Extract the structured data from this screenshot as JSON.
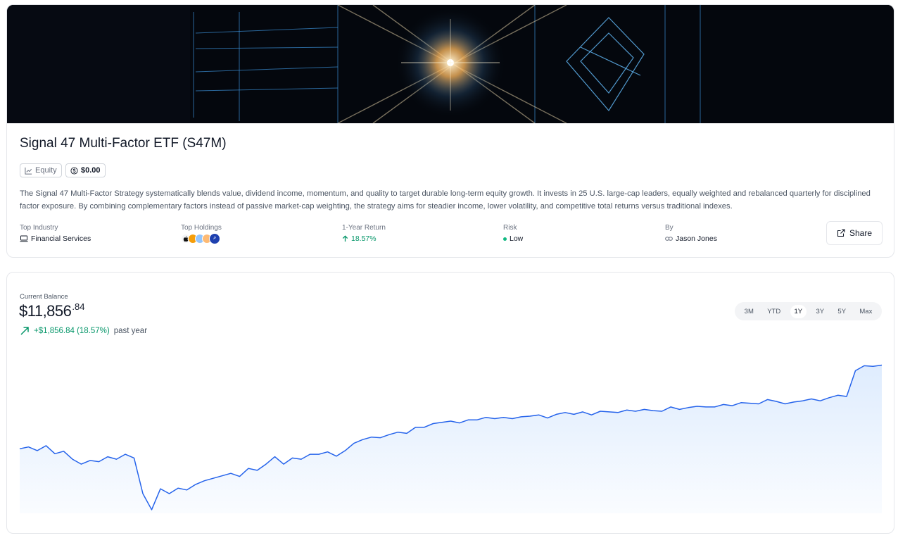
{
  "etf": {
    "title": "Signal 47 Multi-Factor ETF (S47M)",
    "type_badge": "Equity",
    "price_badge": "$0.00",
    "description": "The Signal 47 Multi-Factor Strategy systematically blends value, dividend income, momentum, and quality to target durable long-term equity growth. It invests in 25 U.S. large-cap leaders, equally weighted and rebalanced quarterly for disciplined factor exposure. By combining complementary factors instead of passive market-cap weighting, the strategy aims for steadier income, lower volatility, and competitive total returns versus traditional indexes."
  },
  "stats": {
    "industry_label": "Top Industry",
    "industry_value": "Financial Services",
    "holdings_label": "Top Holdings",
    "holdings_icons": [
      "apple-logo-icon",
      "holding-logo-icon",
      "holding-logo-icon",
      "holding-logo-icon",
      "paypal-logo-icon"
    ],
    "return_label": "1-Year Return",
    "return_value": "18.57%",
    "risk_label": "Risk",
    "risk_value": "Low",
    "by_label": "By",
    "by_value": "Jason Jones"
  },
  "share_label": "Share",
  "balance": {
    "label": "Current Balance",
    "dollars": "$11,856",
    "cents": ".84",
    "change": "+$1,856.84 (18.57%)",
    "period": "past year"
  },
  "ranges": [
    "3M",
    "YTD",
    "1Y",
    "3Y",
    "5Y",
    "Max"
  ],
  "active_range": "1Y",
  "colors": {
    "accent_green": "#059669",
    "line_blue": "#2563eb",
    "fill_blue": "#dbeafe"
  },
  "chart_data": {
    "type": "area",
    "title": "",
    "xlabel": "",
    "ylabel": "",
    "series": [
      {
        "values": [
          10550,
          10580,
          10520,
          10600,
          10470,
          10510,
          10380,
          10300,
          10360,
          10340,
          10420,
          10380,
          10460,
          10400,
          9820,
          9560,
          9900,
          9820,
          9910,
          9880,
          9970,
          10030,
          10070,
          10110,
          10150,
          10100,
          10230,
          10200,
          10300,
          10420,
          10300,
          10400,
          10380,
          10460,
          10460,
          10500,
          10430,
          10520,
          10640,
          10700,
          10740,
          10730,
          10780,
          10820,
          10800,
          10900,
          10900,
          10960,
          10980,
          11000,
          10970,
          11020,
          11020,
          11060,
          11040,
          11060,
          11040,
          11070,
          11080,
          11100,
          11050,
          11110,
          11140,
          11110,
          11150,
          11100,
          11160,
          11150,
          11140,
          11180,
          11160,
          11190,
          11170,
          11160,
          11230,
          11190,
          11220,
          11240,
          11230,
          11230,
          11270,
          11250,
          11300,
          11290,
          11280,
          11350,
          11320,
          11280,
          11310,
          11330,
          11360,
          11330,
          11380,
          11420,
          11400,
          11820,
          11900,
          11890,
          11910
        ]
      }
    ]
  }
}
